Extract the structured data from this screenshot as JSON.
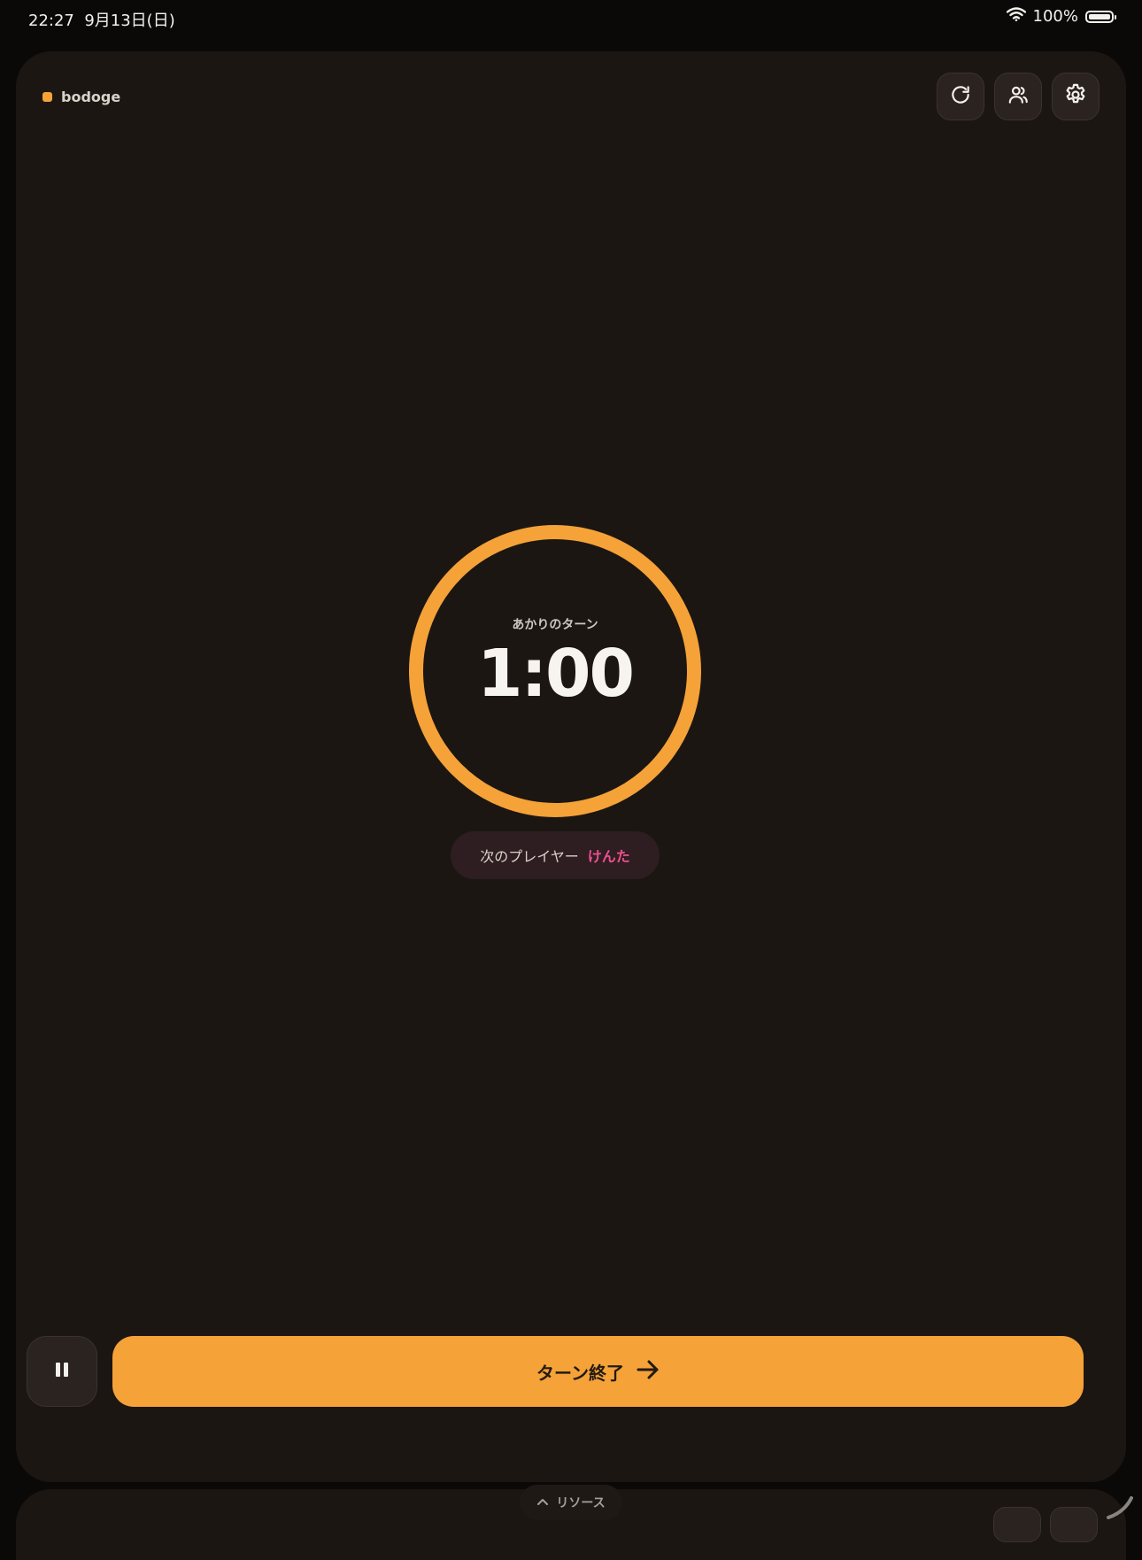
{
  "status_bar": {
    "time": "22:27",
    "date": "9月13日(日)",
    "battery": "100%",
    "battery_level": 1.0
  },
  "header": {
    "brand": "bodoge",
    "brand_color": "#f5a238",
    "buttons": [
      {
        "icon": "refresh-icon"
      },
      {
        "icon": "users-icon"
      },
      {
        "icon": "gear-icon"
      }
    ]
  },
  "timer": {
    "turn_label": "あかりのターン",
    "value": "1:00",
    "progress": 1.0,
    "ring_color": "#f5a238"
  },
  "next_player": {
    "label": "次のプレイヤー",
    "name": "けんた",
    "name_color": "#ec4f8f"
  },
  "controls": {
    "pause_icon": "pause-icon",
    "end_turn_label": "ターン終了",
    "end_turn_icon": "arrow-right-icon",
    "end_turn_color": "#f5a238"
  },
  "drawer": {
    "resource_label": "リソース",
    "resource_icon": "chevron-up-icon"
  }
}
